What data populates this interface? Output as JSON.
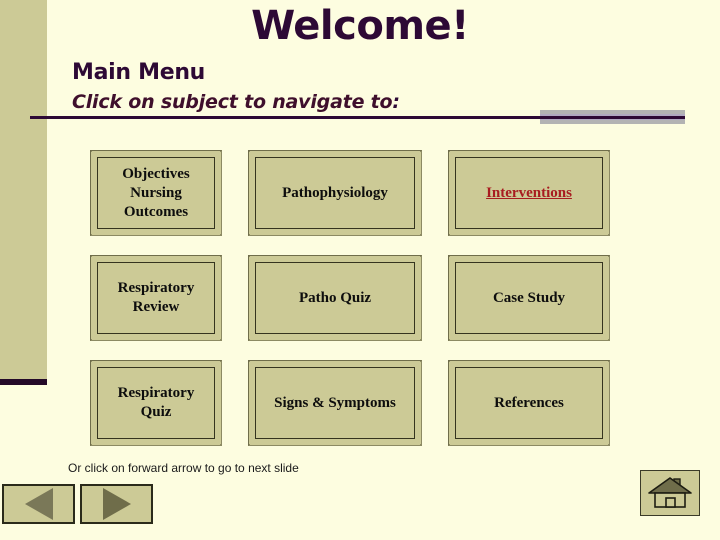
{
  "slide": {
    "heading": "Welcome",
    "heading_punctuation": "!",
    "subheading": "Main Menu",
    "instruction": "Click on subject to navigate to",
    "instruction_punctuation": ":"
  },
  "menu": {
    "rows": [
      [
        {
          "label": "Objectives\nNursing\nOutcomes",
          "style": "plain",
          "name": "menu-button-objectives-nursing-outcomes"
        },
        {
          "label": "Pathophysiology",
          "style": "plain",
          "name": "menu-button-pathophysiology"
        },
        {
          "label": "Interventions",
          "style": "link",
          "name": "menu-button-interventions"
        }
      ],
      [
        {
          "label": "Respiratory\nReview",
          "style": "plain",
          "name": "menu-button-respiratory-review"
        },
        {
          "label": "Patho Quiz",
          "style": "plain",
          "name": "menu-button-patho-quiz"
        },
        {
          "label": "Case Study",
          "style": "plain",
          "name": "menu-button-case-study"
        }
      ],
      [
        {
          "label": "Respiratory\nQuiz",
          "style": "plain",
          "name": "menu-button-respiratory-quiz"
        },
        {
          "label": "Signs & Symptoms",
          "style": "plain",
          "name": "menu-button-signs-and-symptoms"
        },
        {
          "label": "References",
          "style": "plain",
          "name": "menu-button-references"
        }
      ]
    ]
  },
  "footer": {
    "note": "Or click on forward arrow to go to next slide",
    "back_icon": "triangle-left-icon",
    "forward_icon": "triangle-right-icon",
    "home_icon": "home-icon"
  },
  "colors": {
    "background": "#fdfde0",
    "accent_olive": "#ccca96",
    "heading_purple": "#2d0935",
    "link_red": "#a81c20",
    "divider_grey": "#b3b3b3",
    "divider_lavender": "#b0a8c0",
    "button_text": "#0d0d0d"
  }
}
